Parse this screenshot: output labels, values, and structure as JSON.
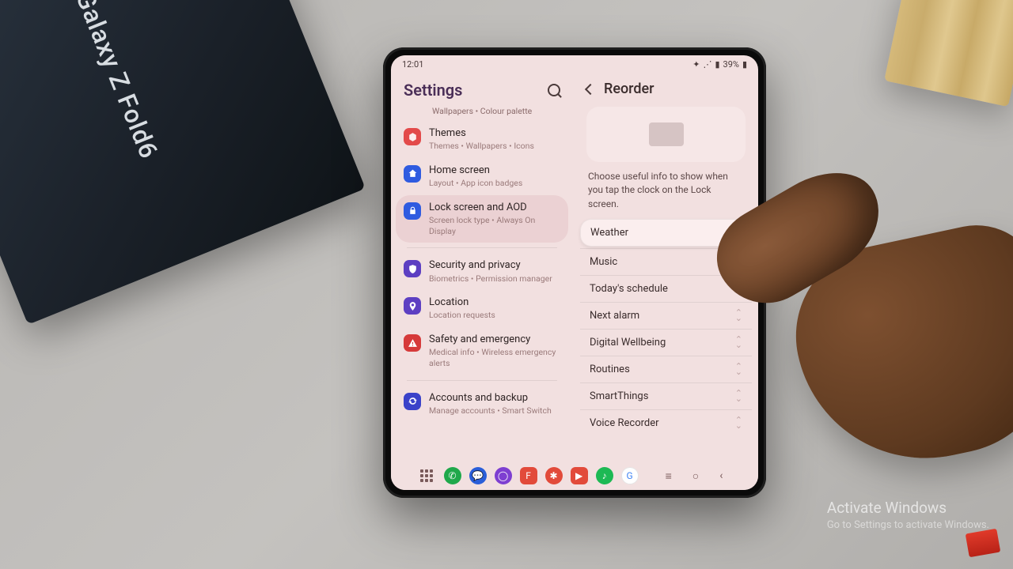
{
  "statusbar": {
    "time": "12:01",
    "battery": "39%"
  },
  "left": {
    "title": "Settings",
    "partial_sub": "Wallpapers  •  Colour palette",
    "items": [
      {
        "icon": "themes",
        "bg": "bg-red",
        "title": "Themes",
        "sub": "Themes  •  Wallpapers  •  Icons"
      },
      {
        "icon": "home",
        "bg": "bg-blue",
        "title": "Home screen",
        "sub": "Layout  •  App icon badges"
      },
      {
        "icon": "lock",
        "bg": "bg-lock",
        "title": "Lock screen and AOD",
        "sub": "Screen lock type  •  Always On Display",
        "selected": true
      },
      {
        "sep_after": true
      },
      {
        "icon": "shield",
        "bg": "bg-purple",
        "title": "Security and privacy",
        "sub": "Biometrics  •  Permission manager"
      },
      {
        "icon": "pin",
        "bg": "bg-purple",
        "title": "Location",
        "sub": "Location requests"
      },
      {
        "icon": "warn",
        "bg": "bg-red2",
        "title": "Safety and emergency",
        "sub": "Medical info  •  Wireless emergency alerts"
      },
      {
        "sep_after": true
      },
      {
        "icon": "sync",
        "bg": "bg-navy",
        "title": "Accounts and backup",
        "sub": "Manage accounts  •  Smart Switch"
      }
    ]
  },
  "right": {
    "title": "Reorder",
    "desc": "Choose useful info to show when you tap the clock on the Lock screen.",
    "items": [
      "Weather",
      "Music",
      "Today's schedule",
      "Next alarm",
      "Digital Wellbeing",
      "Routines",
      "SmartThings",
      "Voice Recorder"
    ]
  },
  "watermark": {
    "line1": "Activate Windows",
    "line2": "Go to Settings to activate Windows."
  },
  "prop": {
    "box_label": "Galaxy Z Fold6"
  }
}
